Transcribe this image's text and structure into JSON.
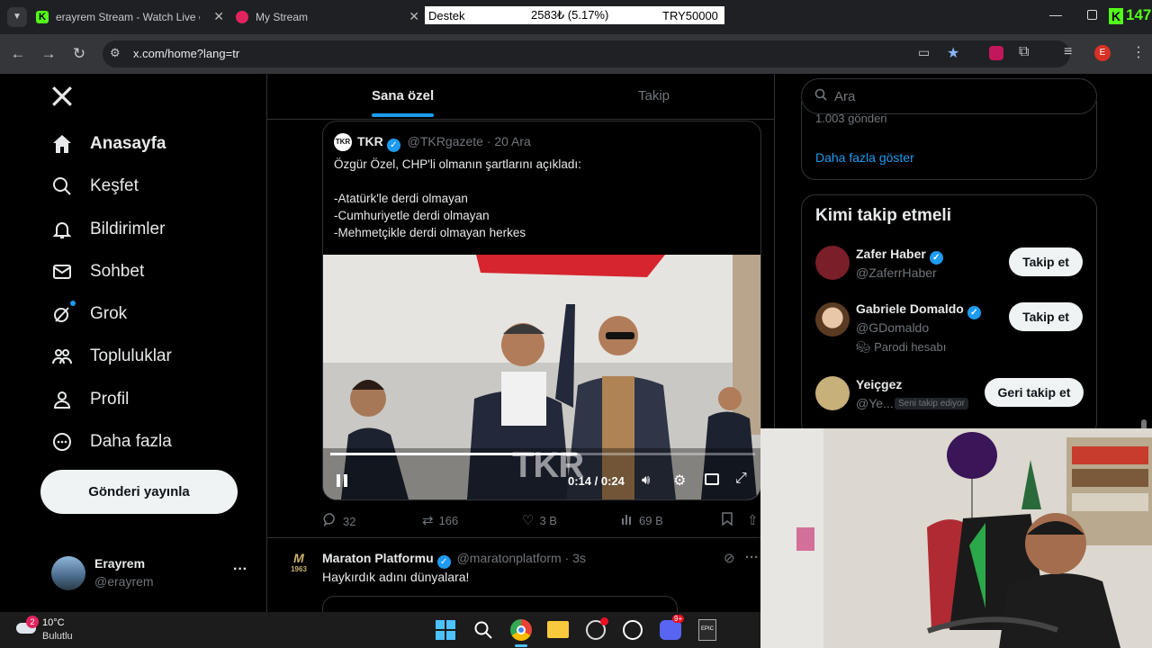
{
  "browser": {
    "tabs": [
      {
        "title": "erayrem Stream - Watch Live o"
      },
      {
        "title": "My Stream"
      }
    ],
    "url": "x.com/home?lang=tr",
    "profile_initial": "E"
  },
  "overlay": {
    "label": "Destek",
    "amount": "2583₺ (5.17%)",
    "goal": "TRY50000"
  },
  "kick_count": "147",
  "sidebar": {
    "items": [
      {
        "label": "Anasayfa",
        "icon": "home-icon"
      },
      {
        "label": "Keşfet",
        "icon": "search-icon"
      },
      {
        "label": "Bildirimler",
        "icon": "bell-icon"
      },
      {
        "label": "Sohbet",
        "icon": "mail-icon"
      },
      {
        "label": "Grok",
        "icon": "grok-icon"
      },
      {
        "label": "Topluluklar",
        "icon": "communities-icon"
      },
      {
        "label": "Profil",
        "icon": "profile-icon"
      },
      {
        "label": "Daha fazla",
        "icon": "more-circle-icon"
      }
    ],
    "post_button": "Gönderi yayınla",
    "account": {
      "name": "Erayrem",
      "handle": "@erayrem",
      "more": "···"
    }
  },
  "timeline": {
    "tabs": [
      "Sana özel",
      "Takip"
    ],
    "quote": {
      "source": "TKR",
      "handle": "@TKRgazete",
      "time": "· 20 Ara",
      "text_lines": [
        "Özgür Özel, CHP'li olmanın şartlarını açıkladı:",
        "",
        "-Atatürk'le derdi olmayan",
        "-Cumhuriyetle derdi olmayan",
        "-Mehmetçikle derdi olmayan herkes"
      ],
      "video": {
        "time": "0:14 / 0:24",
        "watermark": "TKR",
        "progress": 0.58
      }
    },
    "actions": {
      "replies": "32",
      "reposts": "166",
      "likes": "3 B",
      "views": "69 B"
    },
    "next_post": {
      "name": "Maraton Platformu",
      "handle": "@maratonplatform",
      "time": "· 3s",
      "text": "Haykırdık adını dünyalara!",
      "more": "···"
    }
  },
  "right": {
    "search_placeholder": "Ara",
    "trend_count_partial": "1.003 gönderi",
    "show_more": "Daha fazla göster",
    "who_to_follow_title": "Kimi takip etmeli",
    "suggestions": [
      {
        "name": "Zafer Haber",
        "handle": "@ZaferrHaber",
        "button": "Takip et"
      },
      {
        "name": "Gabriele Domaldo",
        "handle": "@GDomaldo",
        "note": "Parodi hesabı",
        "button": "Takip et"
      },
      {
        "name": "Yeiçgez",
        "handle": "@Ye...",
        "badge": "Seni takip ediyor",
        "button": "Geri takip et"
      }
    ]
  },
  "taskbar": {
    "weather_temp": "10°C",
    "weather_desc": "Bulutlu",
    "notification_count": "2",
    "discord_badge": "9+"
  },
  "colors": {
    "accent": "#1d9bf0",
    "background": "#000000",
    "kick_green": "#53fc18"
  }
}
